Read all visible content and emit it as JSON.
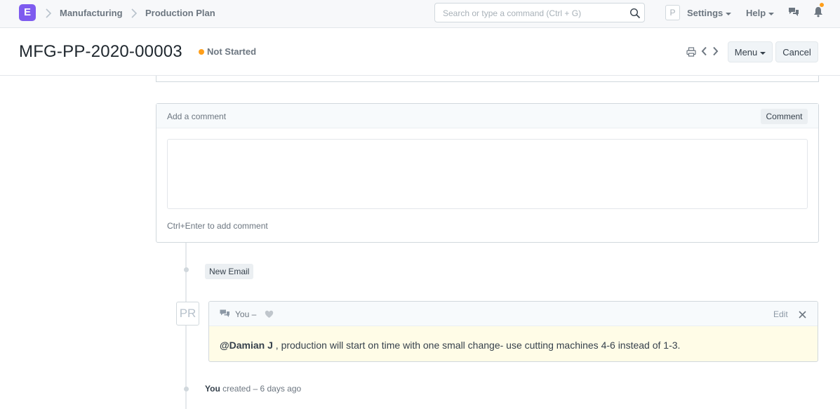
{
  "navbar": {
    "logo_letter": "E",
    "breadcrumbs": [
      "Manufacturing",
      "Production Plan"
    ],
    "search_placeholder": "Search or type a command (Ctrl + G)",
    "user_initial": "P",
    "settings_label": "Settings",
    "help_label": "Help"
  },
  "page": {
    "title": "MFG-PP-2020-00003",
    "status": "Not Started",
    "menu_label": "Menu",
    "cancel_label": "Cancel"
  },
  "comment_box": {
    "header_label": "Add a comment",
    "button_label": "Comment",
    "hint": "Ctrl+Enter to add comment"
  },
  "timeline": {
    "new_email_label": "New Email",
    "comment": {
      "avatar_initials": "PR",
      "author": "You –",
      "edit_label": "Edit",
      "mention": "@Damian J",
      "text": " , production will start on time with one small change- use cutting machines 4-6 instead of 1-3."
    },
    "activity": {
      "actor": "You",
      "text": " created – 6 days ago"
    }
  },
  "colors": {
    "brand": "#7e5bef",
    "status_dot": "#ff9f1a",
    "comment_highlight": "#fffce7"
  }
}
